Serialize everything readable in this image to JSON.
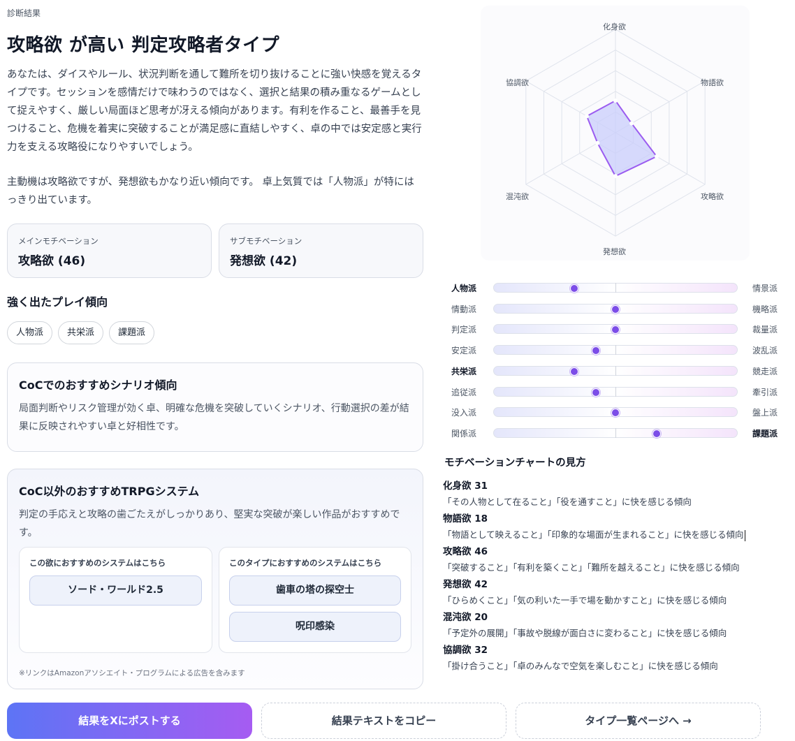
{
  "header": {
    "eyebrow": "診断結果",
    "title": "攻略欲 が高い 判定攻略者タイプ"
  },
  "description": {
    "p1": "あなたは、ダイスやルール、状況判断を通して難所を切り抜けることに強い快感を覚えるタイプです。セッションを感情だけで味わうのではなく、選択と結果の積み重なるゲームとして捉えやすく、厳しい局面ほど思考が冴える傾向があります。有利を作ること、最善手を見つけること、危機を着実に突破することが満足感に直結しやすく、卓の中では安定感と実行力を支える攻略役になりやすいでしょう。",
    "p2": "主動機は攻略欲ですが、発想欲もかなり近い傾向です。 卓上気質では「人物派」が特にはっきり出ています。"
  },
  "motivation": {
    "main_label": "メインモチベーション",
    "main_value": "攻略欲 (46)",
    "sub_label": "サブモチベーション",
    "sub_value": "発想欲 (42)"
  },
  "tendencies": {
    "heading": "強く出たプレイ傾向",
    "tags": [
      "人物派",
      "共栄派",
      "課題派"
    ]
  },
  "coc_card": {
    "title": "CoCでのおすすめシナリオ傾向",
    "body": "局面判断やリスク管理が効く卓、明確な危機を突破していくシナリオ、行動選択の差が結果に反映されやすい卓と好相性です。"
  },
  "other_card": {
    "title": "CoC以外のおすすめTRPGシステム",
    "body": "判定の手応えと攻略の歯ごたえがしっかりあり、堅実な突破が楽しい作品がおすすめです。",
    "left_box_title": "この欲におすすめのシステムはこちら",
    "left_systems": [
      "ソード・ワールド2.5"
    ],
    "right_box_title": "このタイプにおすすめのシステムはこちら",
    "right_systems": [
      "歯車の塔の探空士",
      "呪印感染"
    ],
    "note": "※リンクはAmazonアソシエイト・プログラムによる広告を含みます"
  },
  "buttons": {
    "post": "結果をXにポストする",
    "copy": "結果テキストをコピー",
    "list": "タイプ一覧ページへ →"
  },
  "radar": {
    "axes": [
      "化身欲",
      "物語欲",
      "攻略欲",
      "発想欲",
      "混沌欲",
      "協調欲"
    ],
    "values": [
      31,
      18,
      46,
      42,
      20,
      32
    ],
    "max": 100,
    "fill_color": "#c9cdfb",
    "stroke_color": "#9b5cf0"
  },
  "sliders": [
    {
      "left": "人物派",
      "right": "情景派",
      "value": 0.33,
      "left_bold": true,
      "right_bold": false
    },
    {
      "left": "情動派",
      "right": "機略派",
      "value": 0.5,
      "left_bold": false,
      "right_bold": false
    },
    {
      "left": "判定派",
      "right": "裁量派",
      "value": 0.5,
      "left_bold": false,
      "right_bold": false
    },
    {
      "left": "安定派",
      "right": "波乱派",
      "value": 0.42,
      "left_bold": false,
      "right_bold": false
    },
    {
      "left": "共栄派",
      "right": "競走派",
      "value": 0.33,
      "left_bold": true,
      "right_bold": false
    },
    {
      "left": "追従派",
      "right": "牽引派",
      "value": 0.42,
      "left_bold": false,
      "right_bold": false
    },
    {
      "left": "没入派",
      "right": "盤上派",
      "value": 0.5,
      "left_bold": false,
      "right_bold": false
    },
    {
      "left": "関係派",
      "right": "課題派",
      "value": 0.67,
      "left_bold": false,
      "right_bold": true
    }
  ],
  "howto": {
    "title": "モチベーションチャートの見方",
    "items": [
      {
        "name": "化身欲 31",
        "desc": "「その人物として在ること」「役を通すこと」に快を感じる傾向"
      },
      {
        "name": "物語欲 18",
        "desc": "「物語として映えること」「印象的な場面が生まれること」に快を感じる傾向"
      },
      {
        "name": "攻略欲 46",
        "desc": "「突破すること」「有利を築くこと」「難所を越えること」に快を感じる傾向"
      },
      {
        "name": "発想欲 42",
        "desc": "「ひらめくこと」「気の利いた一手で場を動かすこと」に快を感じる傾向"
      },
      {
        "name": "混沌欲 20",
        "desc": "「予定外の展開」「事故や脱線が面白さに変わること」に快を感じる傾向"
      },
      {
        "name": "協調欲 32",
        "desc": "「掛け合うこと」「卓のみんなで空気を楽しむこと」に快を感じる傾向"
      }
    ]
  }
}
